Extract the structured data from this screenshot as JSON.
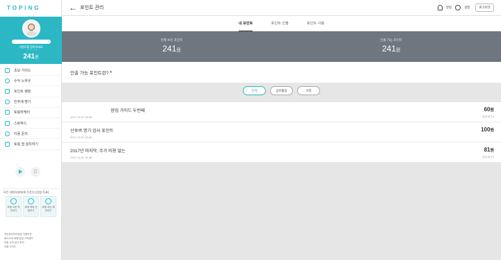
{
  "sidebar": {
    "logo": "TOPING",
    "profile": {
      "sub1": "이벤트를 참여하세요",
      "sub2": "프로필 편집",
      "points": "241",
      "points_unit": "원"
    },
    "menu": [
      {
        "label": "초보 가이드",
        "icon": "book-icon"
      },
      {
        "label": "수익 노하우",
        "icon": "bulb-icon"
      },
      {
        "label": "포인트 랭킹",
        "icon": "trophy-icon"
      },
      {
        "label": "친추에 명기",
        "icon": "friends-icon"
      },
      {
        "label": "토핑하케터",
        "icon": "megaphone-icon"
      },
      {
        "label": "스토박스",
        "icon": "box-icon"
      },
      {
        "label": "이용 문의",
        "icon": "question-icon"
      },
      {
        "label": "토핑 앱 설치하기",
        "icon": "phone-icon"
      }
    ],
    "help": {
      "title": "모든 캐릭터분에게 수운이 (인원 득표)",
      "cards": [
        {
          "label": "토핑 소문 의견하기",
          "icon": "speaker-icon"
        },
        {
          "label": "에게 제휴 신청하기",
          "icon": "globe-icon"
        },
        {
          "label": "토핑 개선 제안하기",
          "icon": "lightbulb-icon"
        }
      ]
    },
    "footer": [
      "개인정보처리방침  이용약관",
      "회사소개 제휴/입점  고객센터",
      "토핑 소개  광고 문의",
      "이용 가이드"
    ]
  },
  "header": {
    "back_icon": "arrow-left-icon",
    "title": "포인트 관리",
    "notice_label": "알림",
    "settings_label": "설정",
    "logout_label": "로그아웃"
  },
  "tabs": [
    {
      "label": "내 포인트",
      "active": true
    },
    {
      "label": "포인트 인출",
      "active": false
    },
    {
      "label": "포인트 사용",
      "active": false
    }
  ],
  "summary": {
    "held_label": "현재 보유 포인트",
    "held_value": "241",
    "withdrawable_label": "인출 가능 포인트",
    "withdrawable_value": "241",
    "unit": "원"
  },
  "info": {
    "label": "인출 가능 포인트란?",
    "caret": "▾"
  },
  "filters": [
    {
      "label": "전체",
      "active": true
    },
    {
      "label": "공유활동",
      "active": false
    },
    {
      "label": "기타",
      "active": false
    }
  ],
  "entries": [
    {
      "title": "참업 가이드 두번째",
      "date": "2017.12.07 15:55",
      "amount": "60",
      "unit": "원",
      "detail": "상세 보기 ▾",
      "indent": true
    },
    {
      "title": "신투버 명기 감사 포인트",
      "date": "2017.12.07 15:54",
      "amount": "100",
      "unit": "원",
      "detail": "",
      "indent": false
    },
    {
      "title": "2017년 마지막, 주가 비용 없는",
      "date": "2017.12.07 15:48",
      "amount": "81",
      "unit": "원",
      "detail": "상세 보기 ▾",
      "indent": false
    }
  ]
}
